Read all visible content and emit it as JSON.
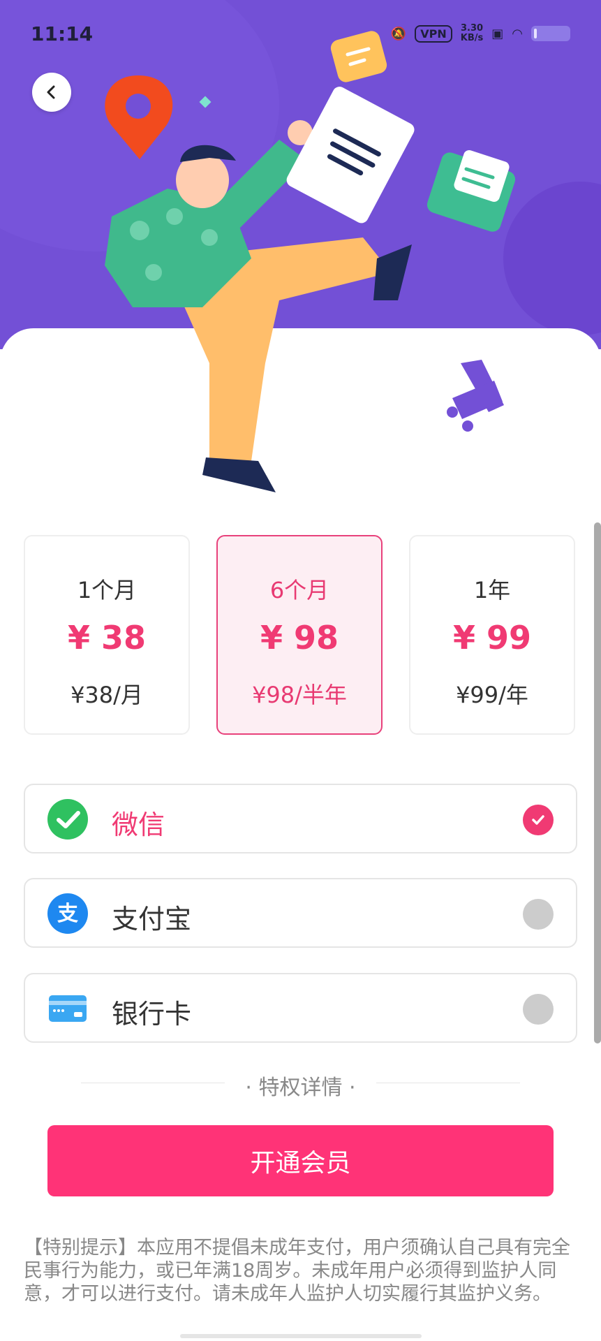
{
  "status_bar": {
    "time": "11:14",
    "vpn": "VPN",
    "speed_value": "3.30",
    "speed_unit": "KB/s"
  },
  "plans": [
    {
      "name": "1个月",
      "price": "¥ 38",
      "per": "¥38/月",
      "selected": false
    },
    {
      "name": "6个月",
      "price": "¥ 98",
      "per": "¥98/半年",
      "selected": true
    },
    {
      "name": "1年",
      "price": "¥ 99",
      "per": "¥99/年",
      "selected": false
    }
  ],
  "payment_methods": [
    {
      "label": "微信",
      "icon": "wechat-icon",
      "selected": true
    },
    {
      "label": "支付宝",
      "icon": "alipay-icon",
      "selected": false
    },
    {
      "label": "银行卡",
      "icon": "bank-card-icon",
      "selected": false
    }
  ],
  "perks_label": "· 特权详情 ·",
  "cta_label": "开通会员",
  "notice": "【特别提示】本应用不提倡未成年支付，用户须确认自己具有完全民事行为能力，或已年满18周岁。未成年用户必须得到监护人同意，才可以进行支付。请未成年人监护人切实履行其监护义务。",
  "colors": {
    "header": "#7350d6",
    "accent": "#ff3377",
    "price": "#f03a73",
    "selected_bg": "#fdeef3"
  }
}
